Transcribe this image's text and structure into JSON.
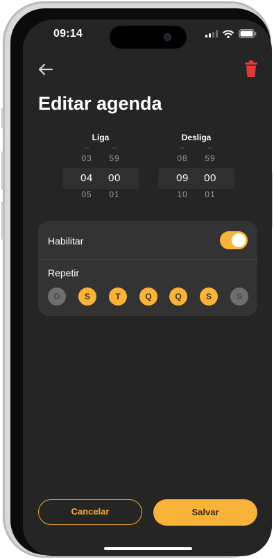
{
  "status_bar": {
    "time": "09:14"
  },
  "page": {
    "title": "Editar agenda"
  },
  "pickers": [
    {
      "label": "Liga",
      "hour": {
        "above_partial": "--",
        "prev": "03",
        "selected": "04",
        "next": "05",
        "below_partial": "--"
      },
      "minute": {
        "above_partial": "--",
        "prev": "59",
        "selected": "00",
        "next": "01",
        "below_partial": "--"
      }
    },
    {
      "label": "Desliga",
      "hour": {
        "above_partial": "--",
        "prev": "08",
        "selected": "09",
        "next": "10",
        "below_partial": "--"
      },
      "minute": {
        "above_partial": "--",
        "prev": "59",
        "selected": "00",
        "next": "01",
        "below_partial": "--"
      }
    }
  ],
  "settings": {
    "enable_label": "Habilitar",
    "enable_on": true,
    "repeat_label": "Repetir",
    "days": [
      {
        "label": "D",
        "active": false
      },
      {
        "label": "S",
        "active": true
      },
      {
        "label": "T",
        "active": true
      },
      {
        "label": "Q",
        "active": true
      },
      {
        "label": "Q",
        "active": true
      },
      {
        "label": "S",
        "active": true
      },
      {
        "label": "S",
        "active": false
      }
    ]
  },
  "actions": {
    "cancel_label": "Cancelar",
    "save_label": "Salvar"
  },
  "colors": {
    "accent": "#f9b339",
    "background": "#252525",
    "card": "#333333",
    "delete": "#e5383b",
    "inactive_day": "#6e6e6e"
  },
  "icons": {
    "back": "arrow-left-icon",
    "delete": "trash-icon"
  }
}
